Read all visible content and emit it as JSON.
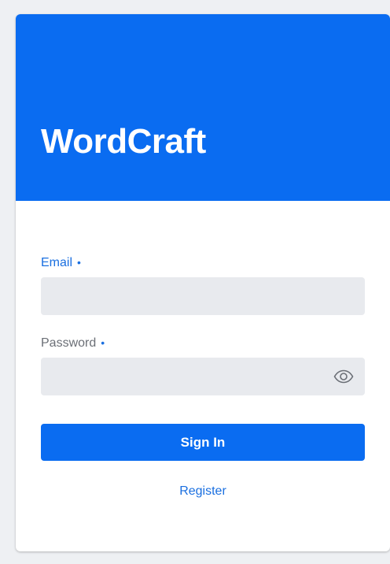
{
  "app": {
    "brand": "WordCraft"
  },
  "form": {
    "email_label": "Email",
    "email_required_mark": "•",
    "email_value": "",
    "password_label": "Password",
    "password_required_mark": "•",
    "password_value": "",
    "show_password_icon": "eye-icon",
    "sign_in_label": "Sign In",
    "register_label": "Register"
  },
  "colors": {
    "brand_blue": "#0a6cf1",
    "link_blue": "#1a6fe0",
    "field_bg": "#e8eaee",
    "page_bg": "#eef0f3"
  }
}
